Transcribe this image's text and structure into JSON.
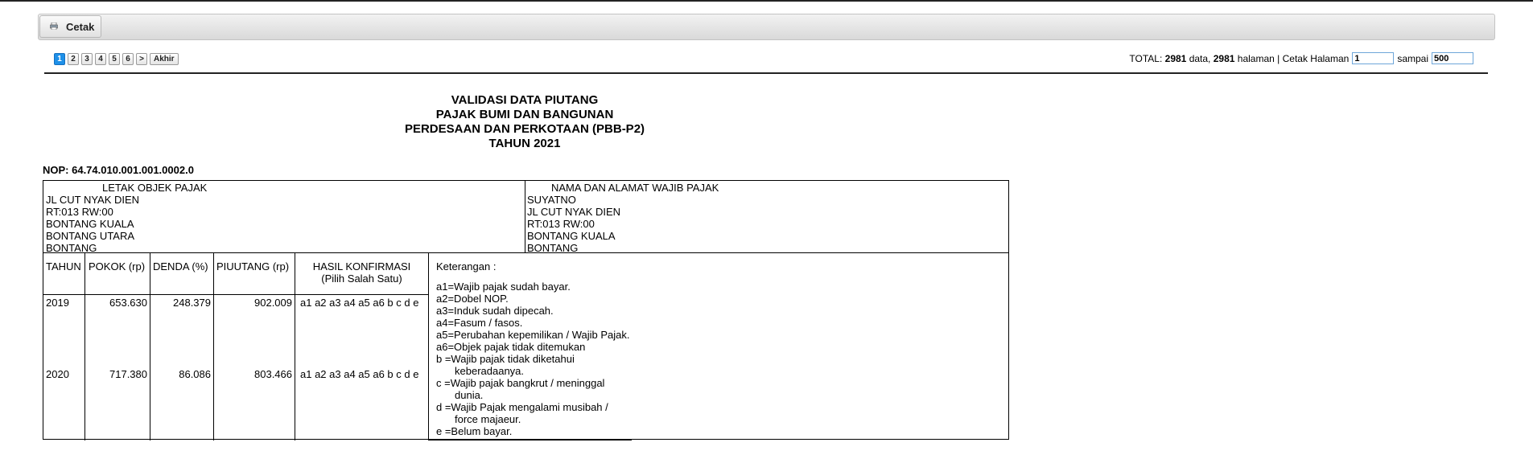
{
  "toolbar": {
    "print_label": "Cetak"
  },
  "pagination": {
    "pages": [
      "1",
      "2",
      "3",
      "4",
      "5",
      "6"
    ],
    "next_label": ">",
    "last_label": "Akhir",
    "active_page": "1"
  },
  "totals": {
    "prefix": "TOTAL:",
    "data_count": "2981",
    "data_label": "data,",
    "page_count": "2981",
    "page_label": "halaman | Cetak Halaman",
    "from_value": "1",
    "to_label": "sampai",
    "to_value": "500"
  },
  "document": {
    "title_lines": [
      "VALIDASI DATA PIUTANG",
      "PAJAK BUMI DAN BANGUNAN",
      "PERDESAAN DAN PERKOTAAN (PBB-P2)",
      "TAHUN 2021"
    ],
    "nop_label": "NOP: 64.74.010.001.001.0002.0",
    "object": {
      "heading": "LETAK OBJEK PAJAK",
      "lines": [
        "JL CUT NYAK DIEN",
        "RT:013 RW:00",
        "BONTANG KUALA",
        "BONTANG UTARA",
        "BONTANG"
      ]
    },
    "taxpayer": {
      "heading": "NAMA DAN ALAMAT WAJIB PAJAK",
      "lines": [
        "SUYATNO",
        "JL CUT NYAK DIEN",
        "RT:013 RW:00",
        "BONTANG KUALA",
        "BONTANG"
      ]
    },
    "table": {
      "headers": [
        "TAHUN",
        "POKOK (rp)",
        "DENDA (%)",
        "PIUUTANG (rp)"
      ],
      "confirm_header": [
        "HASIL KONFIRMASI",
        "(Pilih Salah Satu)"
      ],
      "rows": [
        {
          "year": "2019",
          "pokok": "653.630",
          "denda": "248.379",
          "piutang": "902.009",
          "options": "a1 a2 a3 a4 a5 a6 b c d e"
        },
        {
          "year": "2020",
          "pokok": "717.380",
          "denda": "86.086",
          "piutang": "803.466",
          "options": "a1 a2 a3 a4 a5 a6 b c d e"
        }
      ]
    },
    "notes": {
      "heading": "Keterangan :",
      "lines": [
        "a1=Wajib pajak sudah bayar.",
        "a2=Dobel NOP.",
        "a3=Induk sudah dipecah.",
        "a4=Fasum / fasos.",
        "a5=Perubahan kepemilikan / Wajib Pajak.",
        "a6=Objek pajak tidak ditemukan",
        "b  =Wajib pajak tidak diketahui",
        "keberadaanya.",
        "c  =Wajib pajak bangkrut / meninggal",
        "dunia.",
        "d  =Wajib Pajak mengalami musibah /",
        "force majaeur.",
        "e  =Belum bayar."
      ]
    }
  }
}
